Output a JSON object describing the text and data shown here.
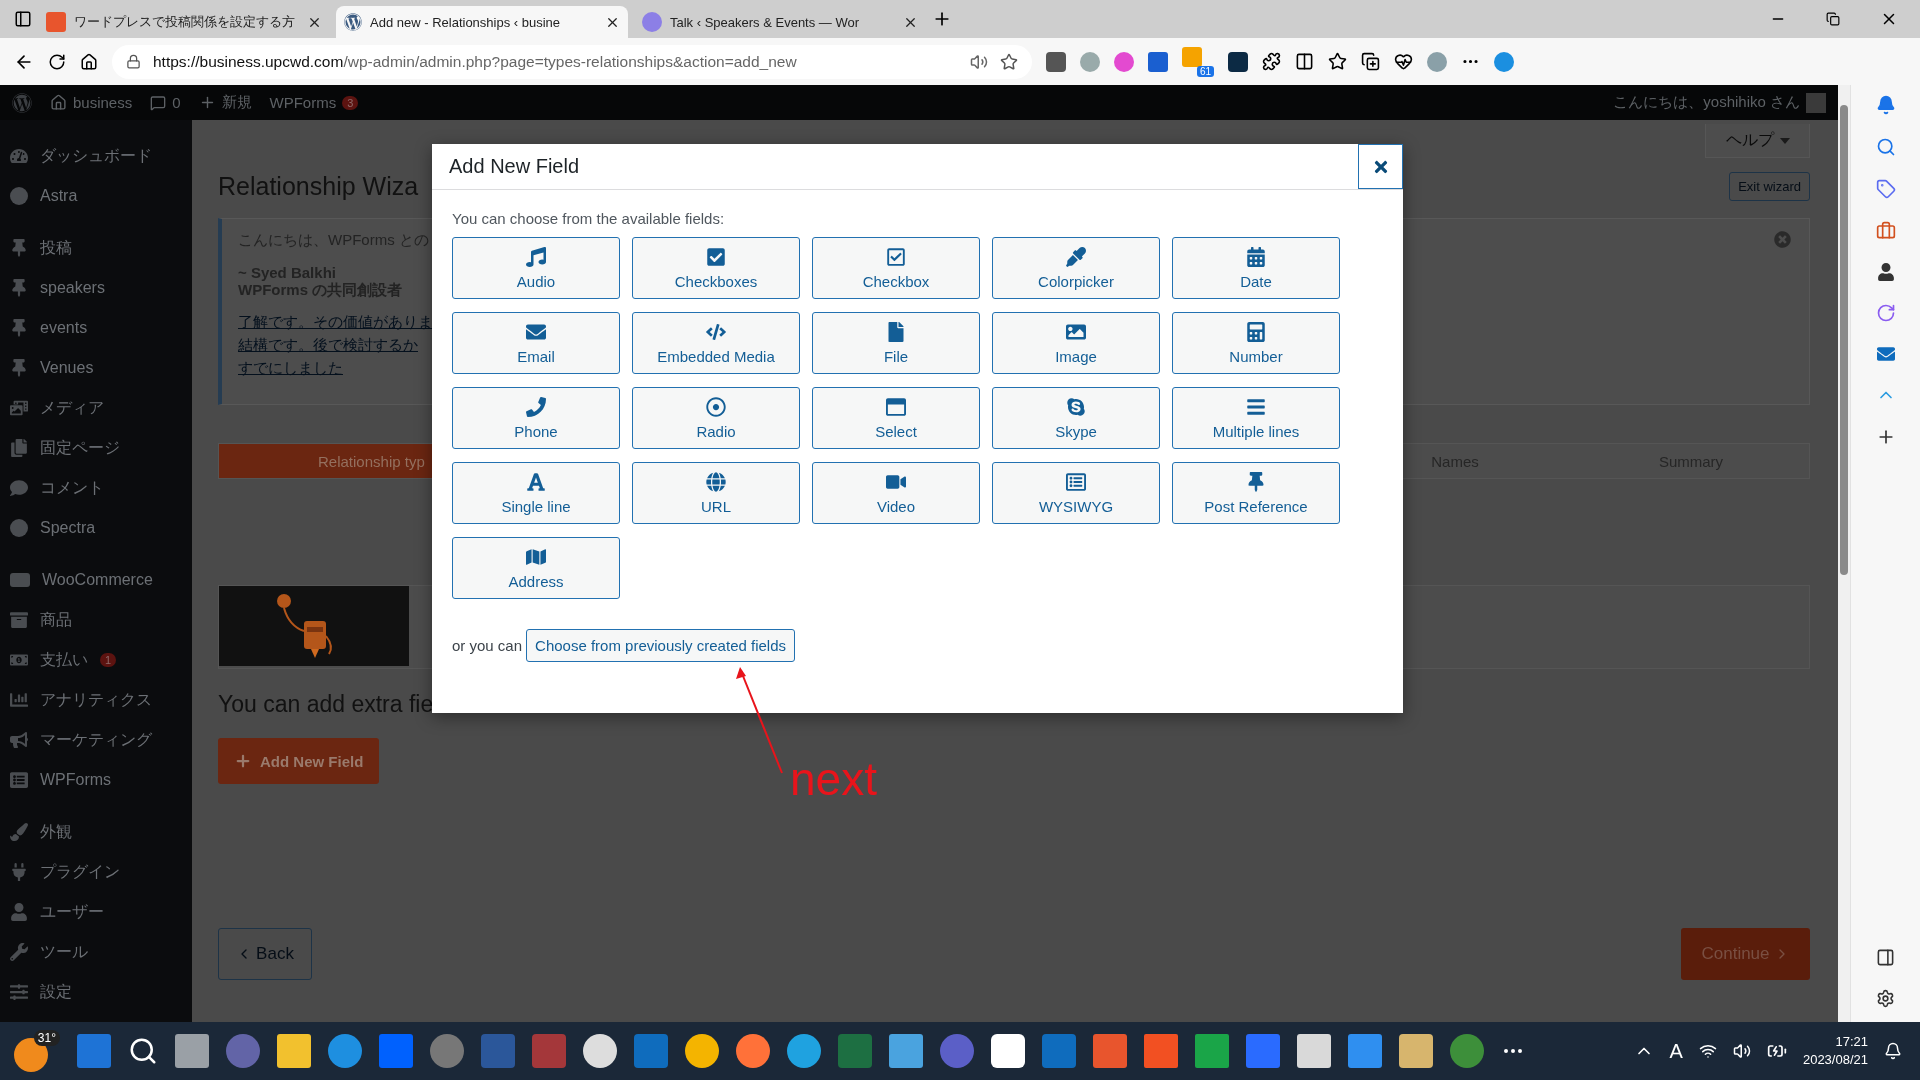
{
  "browser": {
    "tabs": [
      {
        "title": "ワードプレスで投稿関係を設定する方",
        "selected": false
      },
      {
        "title": "Add new - Relationships ‹ busine",
        "selected": true
      },
      {
        "title": "Talk ‹ Speakers & Events — Wor",
        "selected": false
      }
    ],
    "url": {
      "host": "https://business.upcwd.com",
      "path": "/wp-admin/admin.php?page=types-relationships&action=add_new"
    },
    "feed_badge": "61"
  },
  "admin_bar": {
    "site": "business",
    "comments": "0",
    "new": "新規",
    "wpforms": "WPForms",
    "wpforms_badge": "3",
    "greeting": "こんにちは、yoshihiko さん"
  },
  "sidebar": {
    "groups": [
      [
        {
          "label": "ダッシュボード"
        },
        {
          "label": "Astra"
        }
      ],
      [
        {
          "label": "投稿"
        },
        {
          "label": "speakers"
        },
        {
          "label": "events"
        },
        {
          "label": "Venues"
        },
        {
          "label": "メディア"
        },
        {
          "label": "固定ページ"
        },
        {
          "label": "コメント"
        },
        {
          "label": "Spectra"
        }
      ],
      [
        {
          "label": "WooCommerce"
        },
        {
          "label": "商品"
        },
        {
          "label": "支払い",
          "badge": "1"
        },
        {
          "label": "アナリティクス"
        },
        {
          "label": "マーケティング"
        },
        {
          "label": "WPForms"
        }
      ],
      [
        {
          "label": "外観"
        },
        {
          "label": "プラグイン"
        },
        {
          "label": "ユーザー"
        },
        {
          "label": "ツール"
        },
        {
          "label": "設定"
        }
      ]
    ]
  },
  "main": {
    "help": "ヘルプ",
    "title": "Relationship Wiza",
    "exit": "Exit wizard",
    "notice": {
      "greeting": "こんにちは、WPForms との",
      "author": "~ Syed Balkhi",
      "role": "WPForms の共同創設者",
      "links": [
        "了解です。その価値がありま",
        "結構です。後で検討するか",
        "すでにしました"
      ]
    },
    "steps": [
      {
        "label": "Relationship typ",
        "selected": true
      },
      {
        "label": "Names",
        "selected": false
      },
      {
        "label": "Summary",
        "selected": false
      }
    ],
    "extra_text": "You can add extra fie",
    "add_button": "Add New Field",
    "back": "Back",
    "continue": "Continue"
  },
  "modal": {
    "title": "Add New Field",
    "intro": "You can choose from the available fields:",
    "fields": [
      {
        "label": "Audio"
      },
      {
        "label": "Checkboxes"
      },
      {
        "label": "Checkbox"
      },
      {
        "label": "Colorpicker"
      },
      {
        "label": "Date"
      },
      {
        "label": "Email"
      },
      {
        "label": "Embedded Media"
      },
      {
        "label": "File"
      },
      {
        "label": "Image"
      },
      {
        "label": "Number"
      },
      {
        "label": "Phone"
      },
      {
        "label": "Radio"
      },
      {
        "label": "Select"
      },
      {
        "label": "Skype"
      },
      {
        "label": "Multiple lines"
      },
      {
        "label": "Single line"
      },
      {
        "label": "URL"
      },
      {
        "label": "Video"
      },
      {
        "label": "WYSIWYG"
      },
      {
        "label": "Post Reference"
      },
      {
        "label": "Address"
      }
    ],
    "or_text": "or you can",
    "choose_button": "Choose from previously created fields"
  },
  "annotation": {
    "text": "next"
  },
  "taskbar": {
    "weather": "31°",
    "ime": "A",
    "time": "17:21",
    "date": "2023/08/21"
  }
}
